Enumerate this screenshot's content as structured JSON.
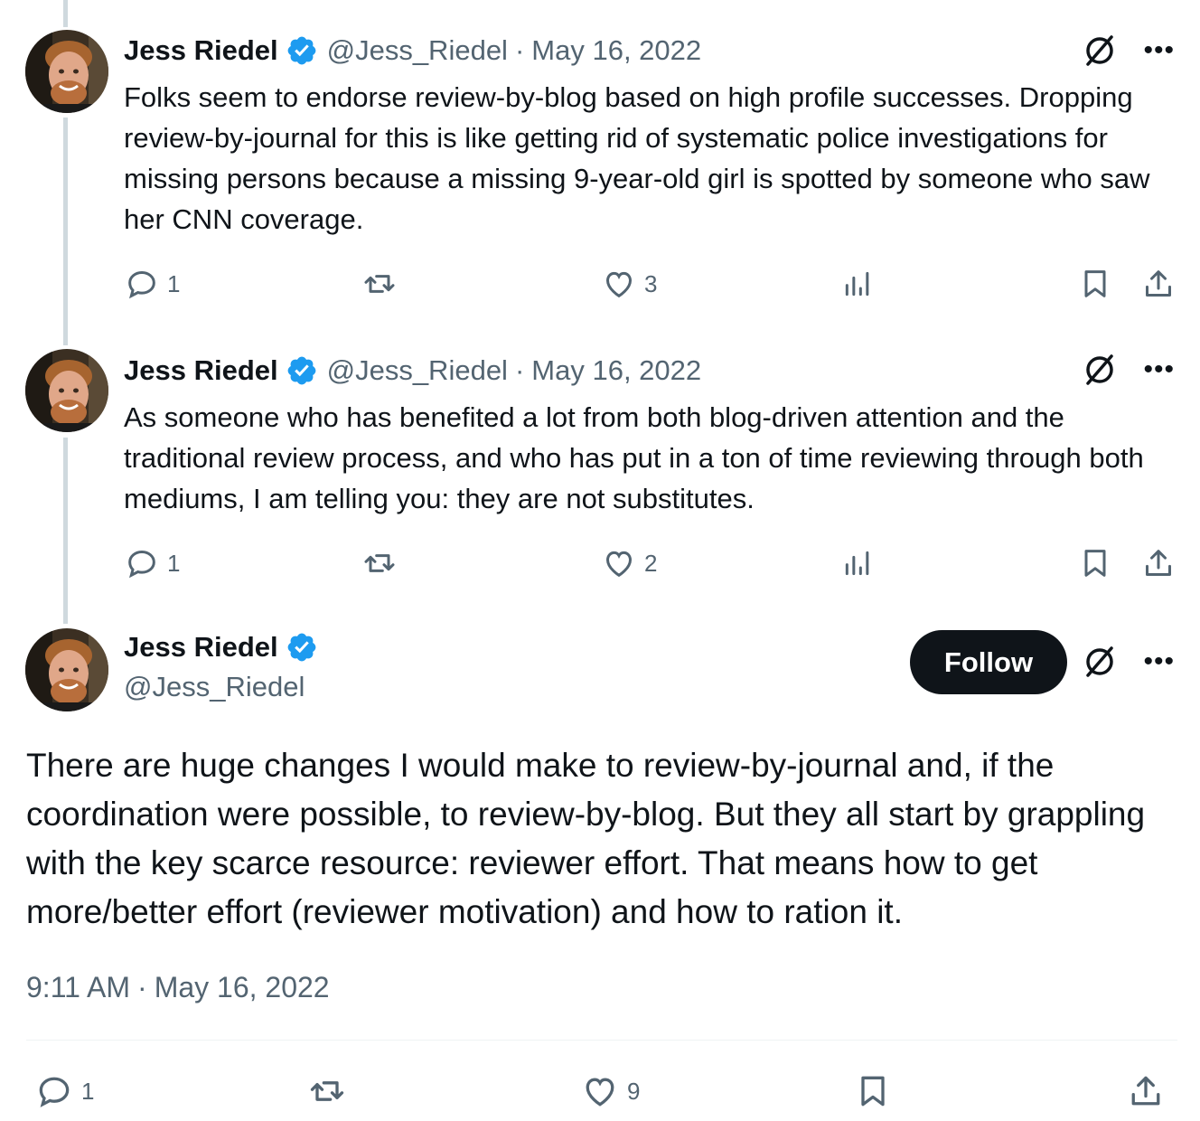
{
  "colors": {
    "text": "#0f1419",
    "muted": "#536471",
    "verified": "#1d9bf0",
    "thread_line": "#cfd9de",
    "follow_bg": "#0f1419"
  },
  "tweets": [
    {
      "author": {
        "name": "Jess Riedel",
        "handle": "@Jess_Riedel",
        "verified": true
      },
      "separator": "·",
      "date": "May 16, 2022",
      "text": "Folks seem to endorse review-by-blog based on high profile successes. Dropping review-by-journal for this is like getting rid of systematic police investigations for missing persons because a missing 9-year-old girl is spotted by someone who saw her CNN coverage.",
      "replies": "1",
      "retweets": "",
      "likes": "3"
    },
    {
      "author": {
        "name": "Jess Riedel",
        "handle": "@Jess_Riedel",
        "verified": true
      },
      "separator": "·",
      "date": "May 16, 2022",
      "text": "As someone who has benefited a lot from both blog-driven attention and the traditional review process, and who has put in a ton of time reviewing through both mediums, I am telling you: they are not substitutes.",
      "replies": "1",
      "retweets": "",
      "likes": "2"
    }
  ],
  "main_tweet": {
    "author": {
      "name": "Jess Riedel",
      "handle": "@Jess_Riedel",
      "verified": true
    },
    "follow_label": "Follow",
    "text": "There are huge changes I would make to review-by-journal and, if the coordination were possible, to review-by-blog. But they all start by grappling with the key scarce resource: reviewer effort. That means how to get more/better effort (reviewer motivation) and how to ration it.",
    "time": "9:11 AM",
    "separator": "·",
    "date": "May 16, 2022",
    "replies": "1",
    "retweets": "",
    "likes": "9"
  },
  "icons": [
    "avatar",
    "verified-badge-icon",
    "grok-icon",
    "more-icon",
    "reply-icon",
    "retweet-icon",
    "like-icon",
    "views-icon",
    "bookmark-icon",
    "share-icon"
  ]
}
